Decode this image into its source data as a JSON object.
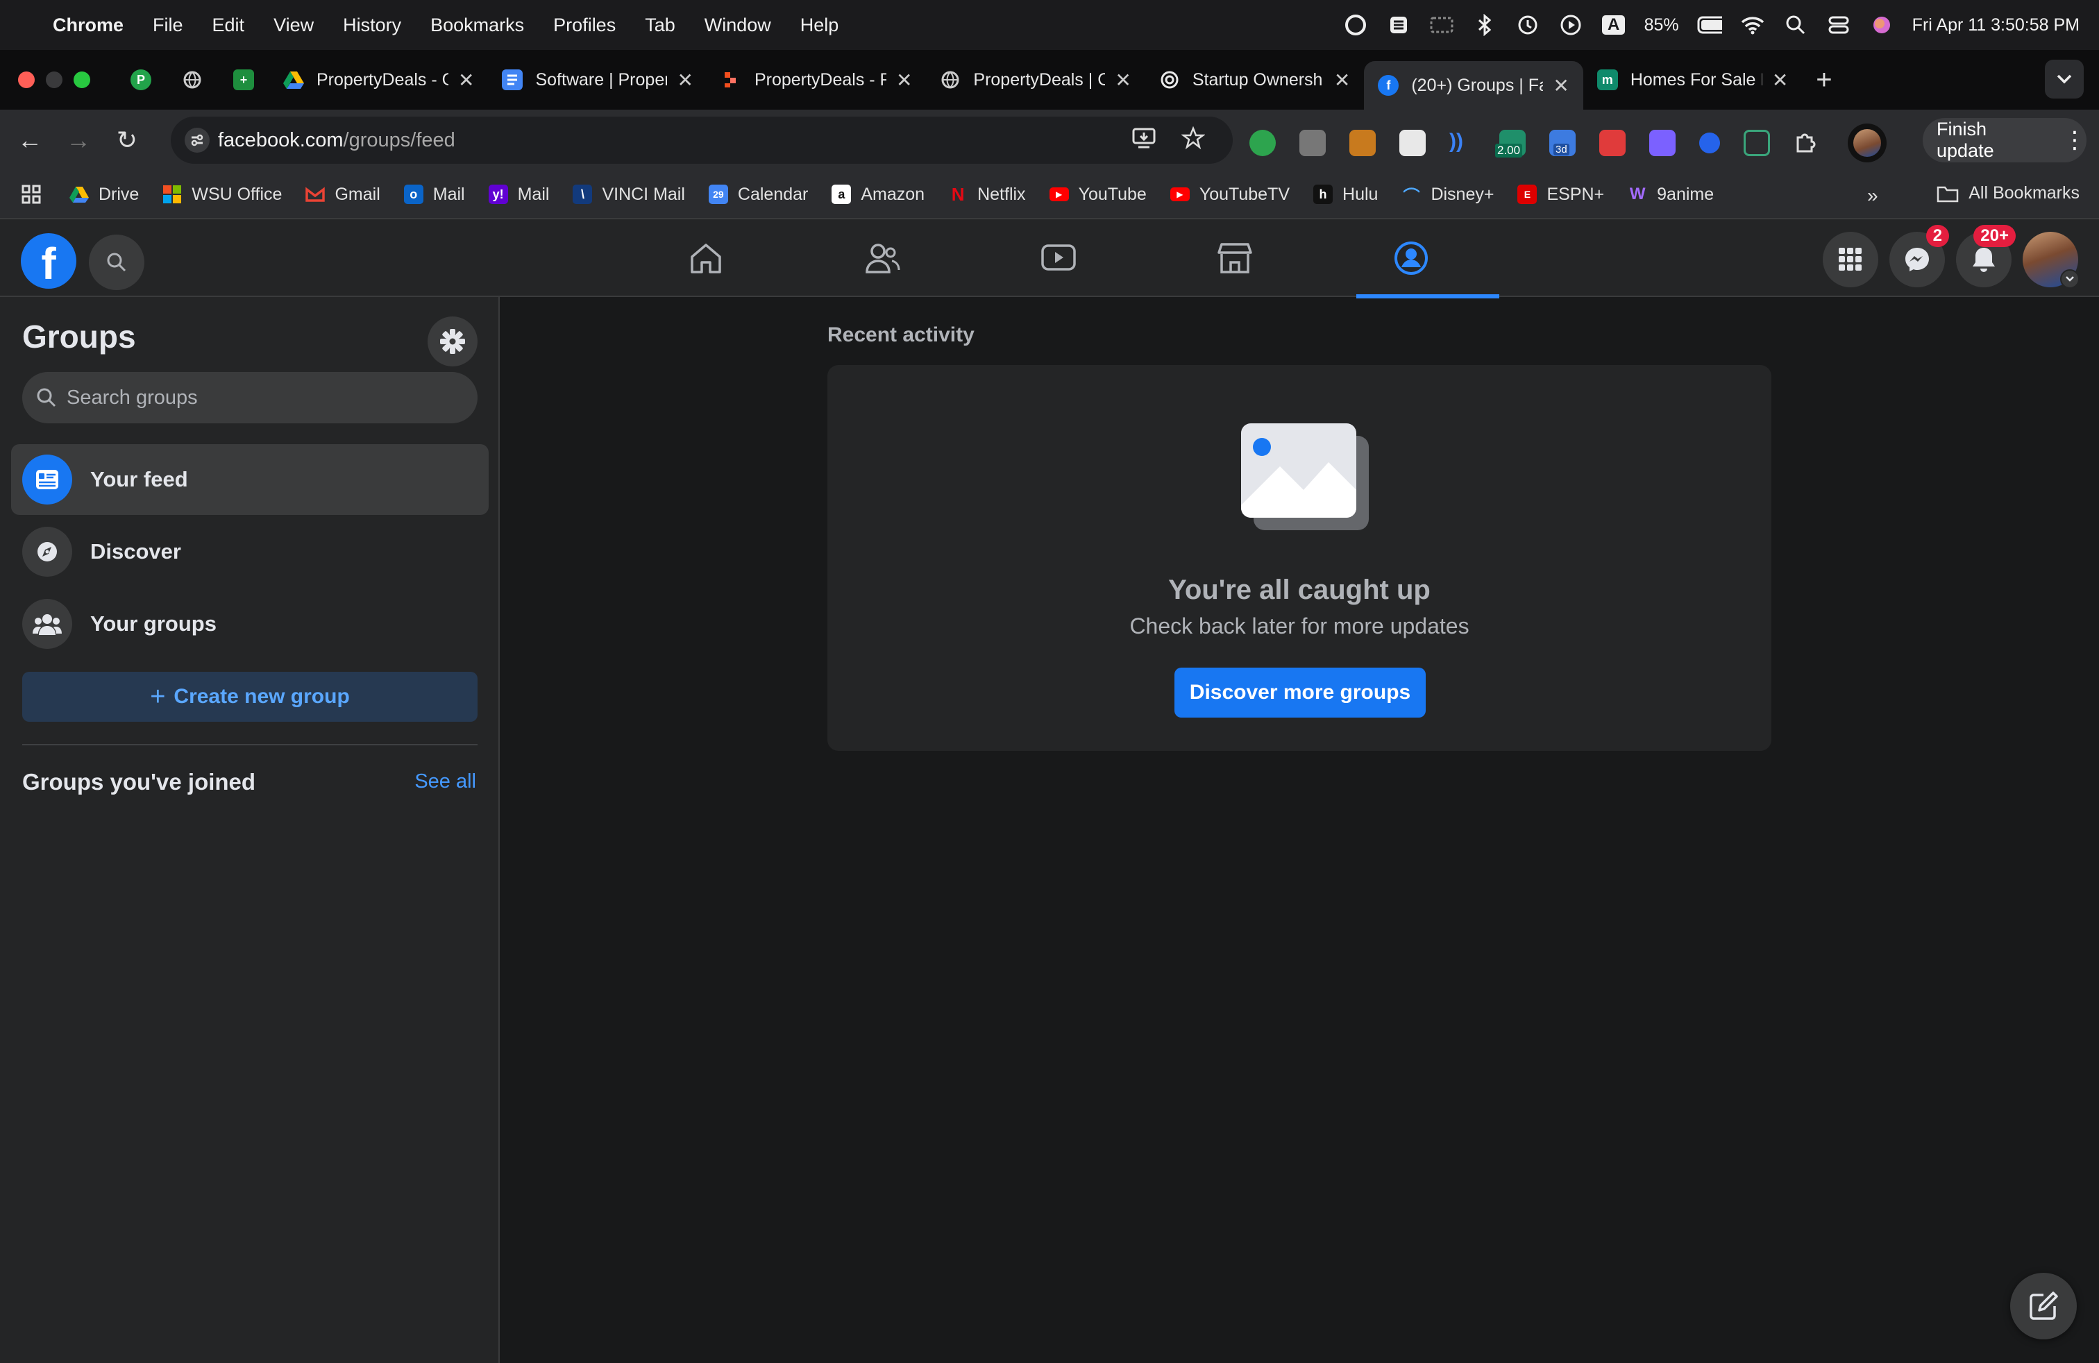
{
  "menubar": {
    "app": "Chrome",
    "items": [
      "File",
      "Edit",
      "View",
      "History",
      "Bookmarks",
      "Profiles",
      "Tab",
      "Window",
      "Help"
    ],
    "battery": "85%",
    "datetime": "Fri Apr 11  3:50:58 PM",
    "tray_letter": "A"
  },
  "tabs": [
    {
      "label": "PropertyDeals - G",
      "icon": "google-drive-icon"
    },
    {
      "label": "Software | Proper",
      "icon": "google-docs-icon"
    },
    {
      "label": "PropertyDeals - F",
      "icon": "figma-like-icon"
    },
    {
      "label": "PropertyDeals | C",
      "icon": "globe-icon"
    },
    {
      "label": "Startup Ownersh",
      "icon": "openai-icon"
    },
    {
      "label": "(20+) Groups | Fa",
      "icon": "facebook-icon",
      "active": true
    },
    {
      "label": "Homes For Sale N",
      "icon": "m-icon"
    }
  ],
  "address": {
    "host": "facebook.com",
    "path": "/groups/feed",
    "ext_badge": "2.00",
    "ext_badge2": "3d"
  },
  "finish_update": "Finish update",
  "bookmarks": [
    {
      "label": "Drive"
    },
    {
      "label": "WSU Office"
    },
    {
      "label": "Gmail"
    },
    {
      "label": "Mail"
    },
    {
      "label": "Mail"
    },
    {
      "label": "VINCI Mail"
    },
    {
      "label": "Calendar"
    },
    {
      "label": "Amazon"
    },
    {
      "label": "Netflix"
    },
    {
      "label": "YouTube"
    },
    {
      "label": "YouTubeTV"
    },
    {
      "label": "Hulu"
    },
    {
      "label": "Disney+"
    },
    {
      "label": "ESPN+"
    },
    {
      "label": "9anime"
    }
  ],
  "all_bookmarks": "All Bookmarks",
  "fb": {
    "messenger_badge": "2",
    "notifications_badge": "20+"
  },
  "sidebar": {
    "title": "Groups",
    "search_placeholder": "Search groups",
    "items": [
      {
        "label": "Your feed",
        "active": true
      },
      {
        "label": "Discover"
      },
      {
        "label": "Your groups"
      }
    ],
    "create_label": "Create new group",
    "joined_title": "Groups you've joined",
    "see_all": "See all"
  },
  "main": {
    "recent_activity": "Recent activity",
    "caught_up": "You're all caught up",
    "check_back": "Check back later for more updates",
    "discover_button": "Discover more groups"
  },
  "colors": {
    "fb_blue": "#1877f2",
    "bg": "#18191a",
    "surface": "#242526"
  }
}
